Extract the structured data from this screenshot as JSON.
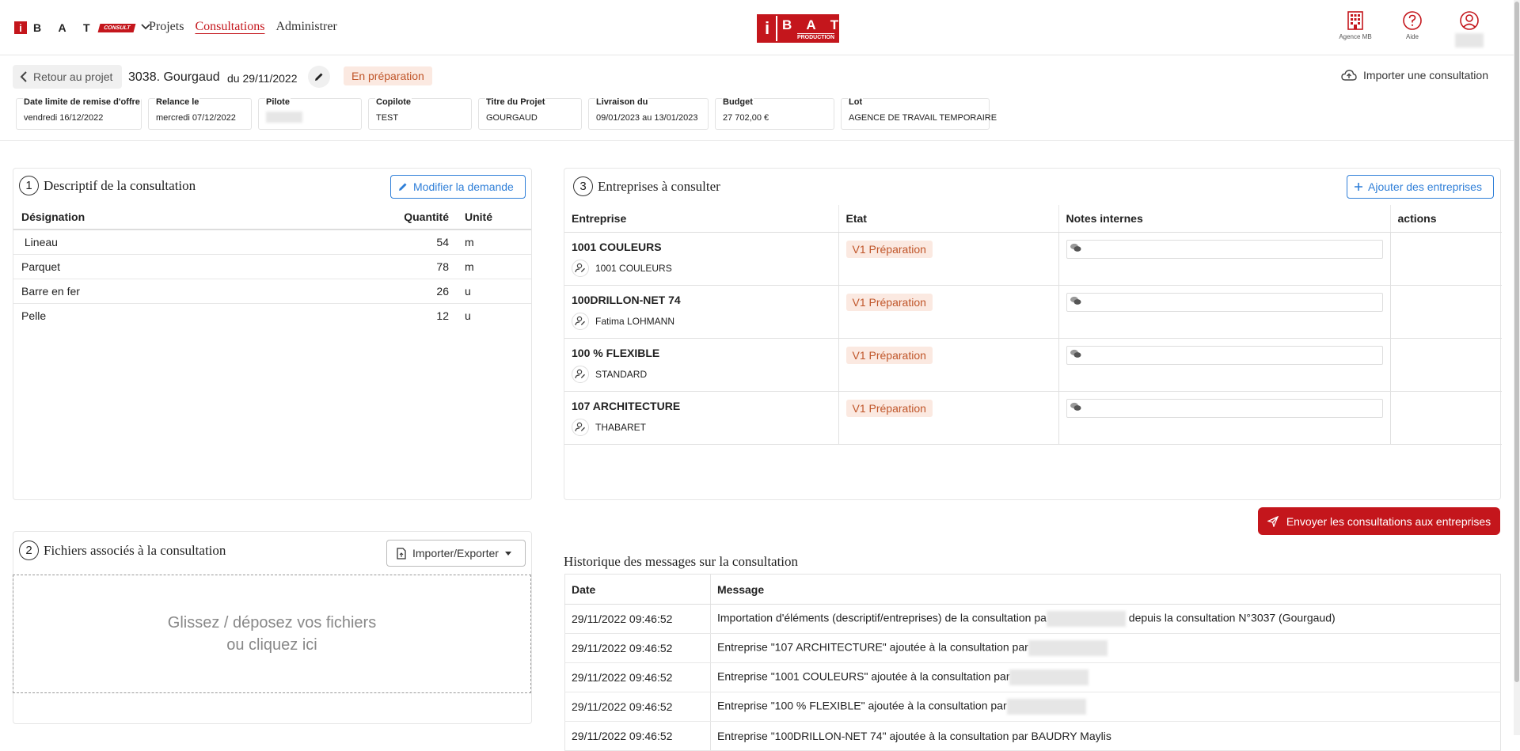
{
  "nav": {
    "brand_letter": "i",
    "brand_name": "B A T",
    "brand_tag": "CONSULT",
    "links": [
      "Projets",
      "Consultations",
      "Administrer"
    ],
    "center_logo_letter": "i",
    "center_logo_name": "B A T",
    "center_logo_tag": "PRODUCTION",
    "agence_label": "Agence MB",
    "aide_label": "Aide"
  },
  "header": {
    "back_label": "Retour au projet",
    "project_title": "3038. Gourgaud",
    "project_date": "du 29/11/2022",
    "status": "En préparation",
    "import_label": "Importer une consultation"
  },
  "fields": [
    {
      "label": "Date limite de remise d'offre",
      "value": "vendredi 16/12/2022"
    },
    {
      "label": "Relance le",
      "value": "mercredi 07/12/2022"
    },
    {
      "label": "Pilote",
      "value": ""
    },
    {
      "label": "Copilote",
      "value": "TEST"
    },
    {
      "label": "Titre du Projet",
      "value": "GOURGAUD"
    },
    {
      "label": "Livraison du",
      "value": "09/01/2023 au 13/01/2023"
    },
    {
      "label": "Budget",
      "value": "27 702,00 €"
    },
    {
      "label": "Lot",
      "value": "AGENCE DE TRAVAIL TEMPORAIRE"
    }
  ],
  "descriptif": {
    "number": "1",
    "title": "Descriptif de la consultation",
    "modify_label": "Modifier la demande",
    "columns": {
      "designation": "Désignation",
      "quantite": "Quantité",
      "unite": "Unité"
    },
    "rows": [
      {
        "designation": " Lineau",
        "quantite": "54",
        "unite": "m"
      },
      {
        "designation": "Parquet",
        "quantite": "78",
        "unite": "m"
      },
      {
        "designation": "Barre en fer",
        "quantite": "26",
        "unite": "u"
      },
      {
        "designation": "Pelle",
        "quantite": "12",
        "unite": "u"
      }
    ]
  },
  "fichiers": {
    "number": "2",
    "title": "Fichiers associés à la consultation",
    "import_export_label": "Importer/Exporter",
    "drop_line1": "Glissez / déposez vos fichiers",
    "drop_line2": "ou cliquez ici"
  },
  "entreprises": {
    "number": "3",
    "title": "Entreprises à consulter",
    "add_label": "Ajouter des entreprises",
    "columns": {
      "entreprise": "Entreprise",
      "etat": "Etat",
      "notes": "Notes internes",
      "actions": "actions"
    },
    "rows": [
      {
        "name": "1001 COULEURS",
        "contact": "1001 COULEURS",
        "etat": "V1 Préparation"
      },
      {
        "name": "100DRILLON-NET 74",
        "contact": "Fatima LOHMANN",
        "etat": "V1 Préparation"
      },
      {
        "name": "100 % FLEXIBLE",
        "contact": "STANDARD",
        "etat": "V1 Préparation"
      },
      {
        "name": "107 ARCHITECTURE",
        "contact": "THABARET",
        "etat": "V1 Préparation"
      }
    ]
  },
  "send_label": "Envoyer les consultations aux entreprises",
  "historique": {
    "title": "Historique des messages sur la consultation",
    "columns": {
      "date": "Date",
      "message": "Message"
    },
    "rows": [
      {
        "date": "29/11/2022 09:46:52",
        "message_a": "Importation d'éléments (descriptif/entreprises) de la consultation pa",
        "message_b": " depuis la consultation N°3037 (Gourgaud)"
      },
      {
        "date": "29/11/2022 09:46:52",
        "message_a": "Entreprise \"107 ARCHITECTURE\" ajoutée à la consultation par",
        "message_b": ""
      },
      {
        "date": "29/11/2022 09:46:52",
        "message_a": "Entreprise \"1001 COULEURS\" ajoutée à la consultation par",
        "message_b": ""
      },
      {
        "date": "29/11/2022 09:46:52",
        "message_a": "Entreprise \"100 % FLEXIBLE\" ajoutée à la consultation par",
        "message_b": ""
      },
      {
        "date": "29/11/2022 09:46:52",
        "message_a": "Entreprise \"100DRILLON-NET 74\" ajoutée à la consultation par BAUDRY Maylis",
        "message_b": ""
      }
    ]
  },
  "colors": {
    "brand_red": "#c4161c",
    "link_blue": "#2f7fd8",
    "status_bg": "#fbe9e1",
    "status_text": "#c0562a"
  }
}
